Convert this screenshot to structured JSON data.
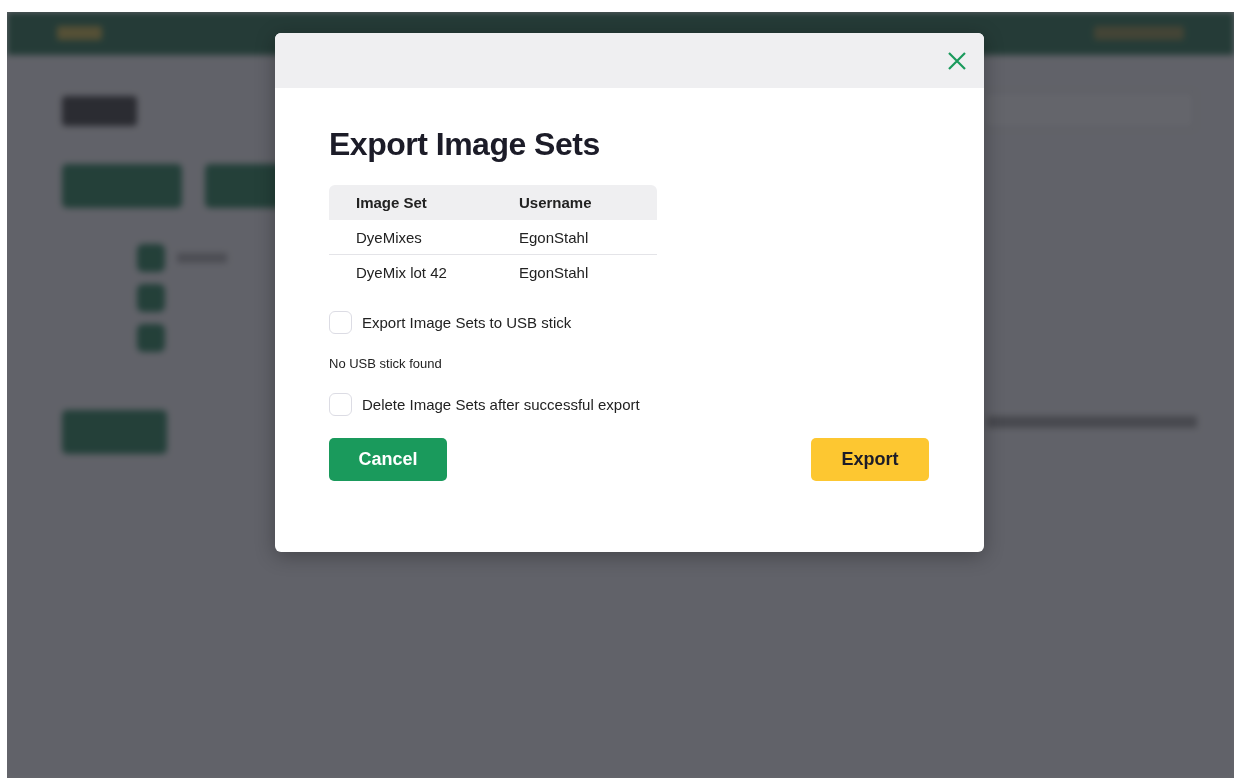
{
  "dialog": {
    "title": "Export Image Sets",
    "table": {
      "columns": [
        "Image Set",
        "Username"
      ],
      "rows": [
        [
          "DyeMixes",
          "EgonStahl"
        ],
        [
          "DyeMix lot 42",
          "EgonStahl"
        ]
      ]
    },
    "options": [
      {
        "kind": "checkbox",
        "label": "Export Image Sets to USB stick",
        "checked": false
      },
      {
        "kind": "note",
        "label": "No USB stick found"
      },
      {
        "kind": "checkbox",
        "label": "Delete Image Sets after successful export",
        "checked": false
      }
    ],
    "buttons": [
      {
        "label": "Cancel",
        "kind": "secondary"
      },
      {
        "label": "Export",
        "kind": "primary"
      }
    ]
  }
}
